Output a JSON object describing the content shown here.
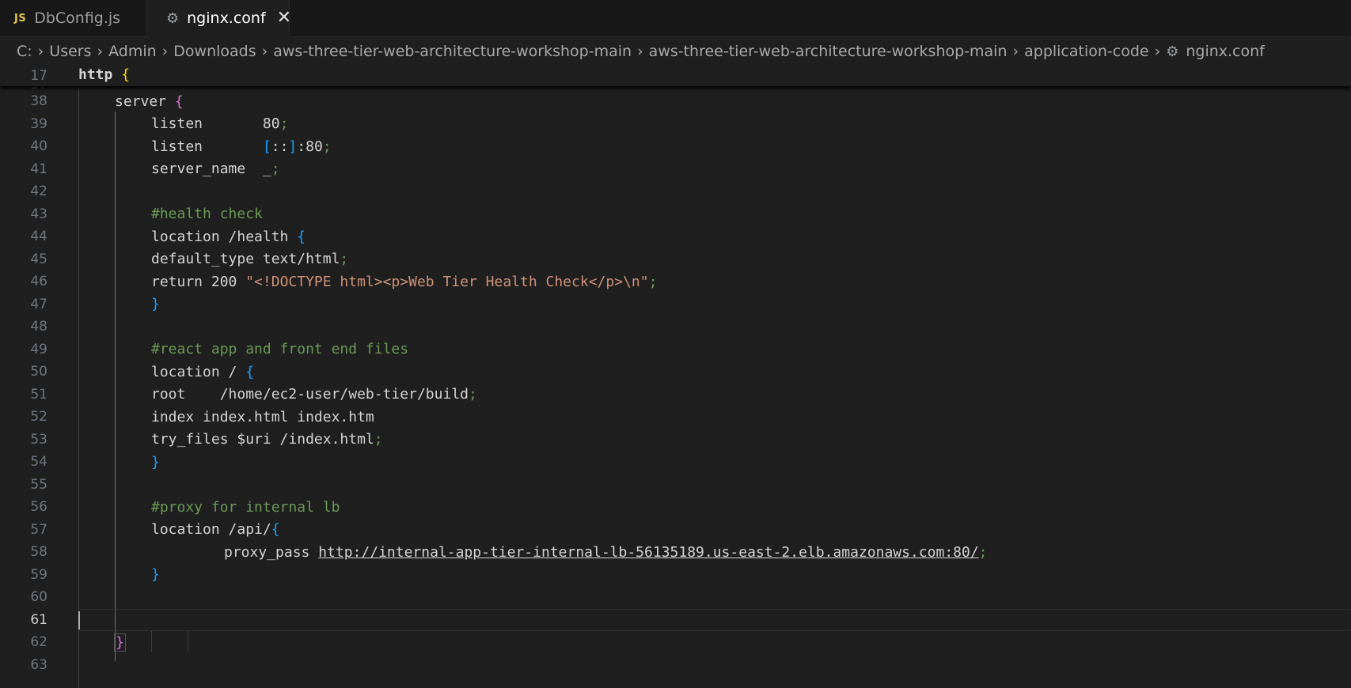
{
  "tabs": [
    {
      "icon": "JS",
      "label": "DbConfig.js"
    },
    {
      "label": "nginx.conf",
      "close": "✕"
    }
  ],
  "breadcrumb": [
    "C:",
    "Users",
    "Admin",
    "Downloads",
    "aws-three-tier-web-architecture-workshop-main",
    "aws-three-tier-web-architecture-workshop-main",
    "application-code",
    "nginx.conf"
  ],
  "sticky": {
    "ln": "17",
    "code": "http",
    "brace": "{"
  },
  "editor": {
    "partial_ln": "37",
    "current_line": "61",
    "lines": {
      "l38": {
        "ln": "38",
        "kw": "server",
        "brace": "{"
      },
      "l39": {
        "ln": "39",
        "kw": "listen       ",
        "val": "80",
        "semi": ";"
      },
      "l40": {
        "ln": "40",
        "kw": "listen       ",
        "ob": "[",
        "val": "::",
        "cb": "]",
        "val2": ":80",
        "semi": ";"
      },
      "l41": {
        "ln": "41",
        "kw": "server_name  _",
        "semi": ";"
      },
      "l42": {
        "ln": "42"
      },
      "l43": {
        "ln": "43",
        "comment": "#health check"
      },
      "l44": {
        "ln": "44",
        "kw": "location /health ",
        "brace": "{"
      },
      "l45": {
        "ln": "45",
        "kw": "default_type text/html",
        "semi": ";"
      },
      "l46": {
        "ln": "46",
        "kw": "return 200 ",
        "str": "\"<!DOCTYPE html><p>Web Tier Health Check</p>\\n\"",
        "semi": ";"
      },
      "l47": {
        "ln": "47",
        "brace": "}"
      },
      "l48": {
        "ln": "48"
      },
      "l49": {
        "ln": "49",
        "comment": "#react app and front end files"
      },
      "l50": {
        "ln": "50",
        "kw": "location / ",
        "brace": "{"
      },
      "l51": {
        "ln": "51",
        "kw": "root    /home/ec2-user/web-tier/build",
        "semi": ";"
      },
      "l52": {
        "ln": "52",
        "kw": "index index.html index.htm"
      },
      "l53": {
        "ln": "53",
        "kw": "try_files $uri /index.html",
        "semi": ";"
      },
      "l54": {
        "ln": "54",
        "brace": "}"
      },
      "l55": {
        "ln": "55"
      },
      "l56": {
        "ln": "56",
        "comment": "#proxy for internal lb"
      },
      "l57": {
        "ln": "57",
        "kw": "location /api/",
        "brace": "{"
      },
      "l58": {
        "ln": "58",
        "kw": "proxy_pass ",
        "url": "http://internal-app-tier-internal-lb-56135189.us-east-2.elb.amazonaws.com:80/",
        "semi": ";"
      },
      "l59": {
        "ln": "59",
        "brace": "}"
      },
      "l60": {
        "ln": "60"
      },
      "l61": {
        "ln": "61"
      },
      "l62": {
        "ln": "62",
        "brace": "}"
      },
      "l63": {
        "ln": "63"
      }
    }
  }
}
